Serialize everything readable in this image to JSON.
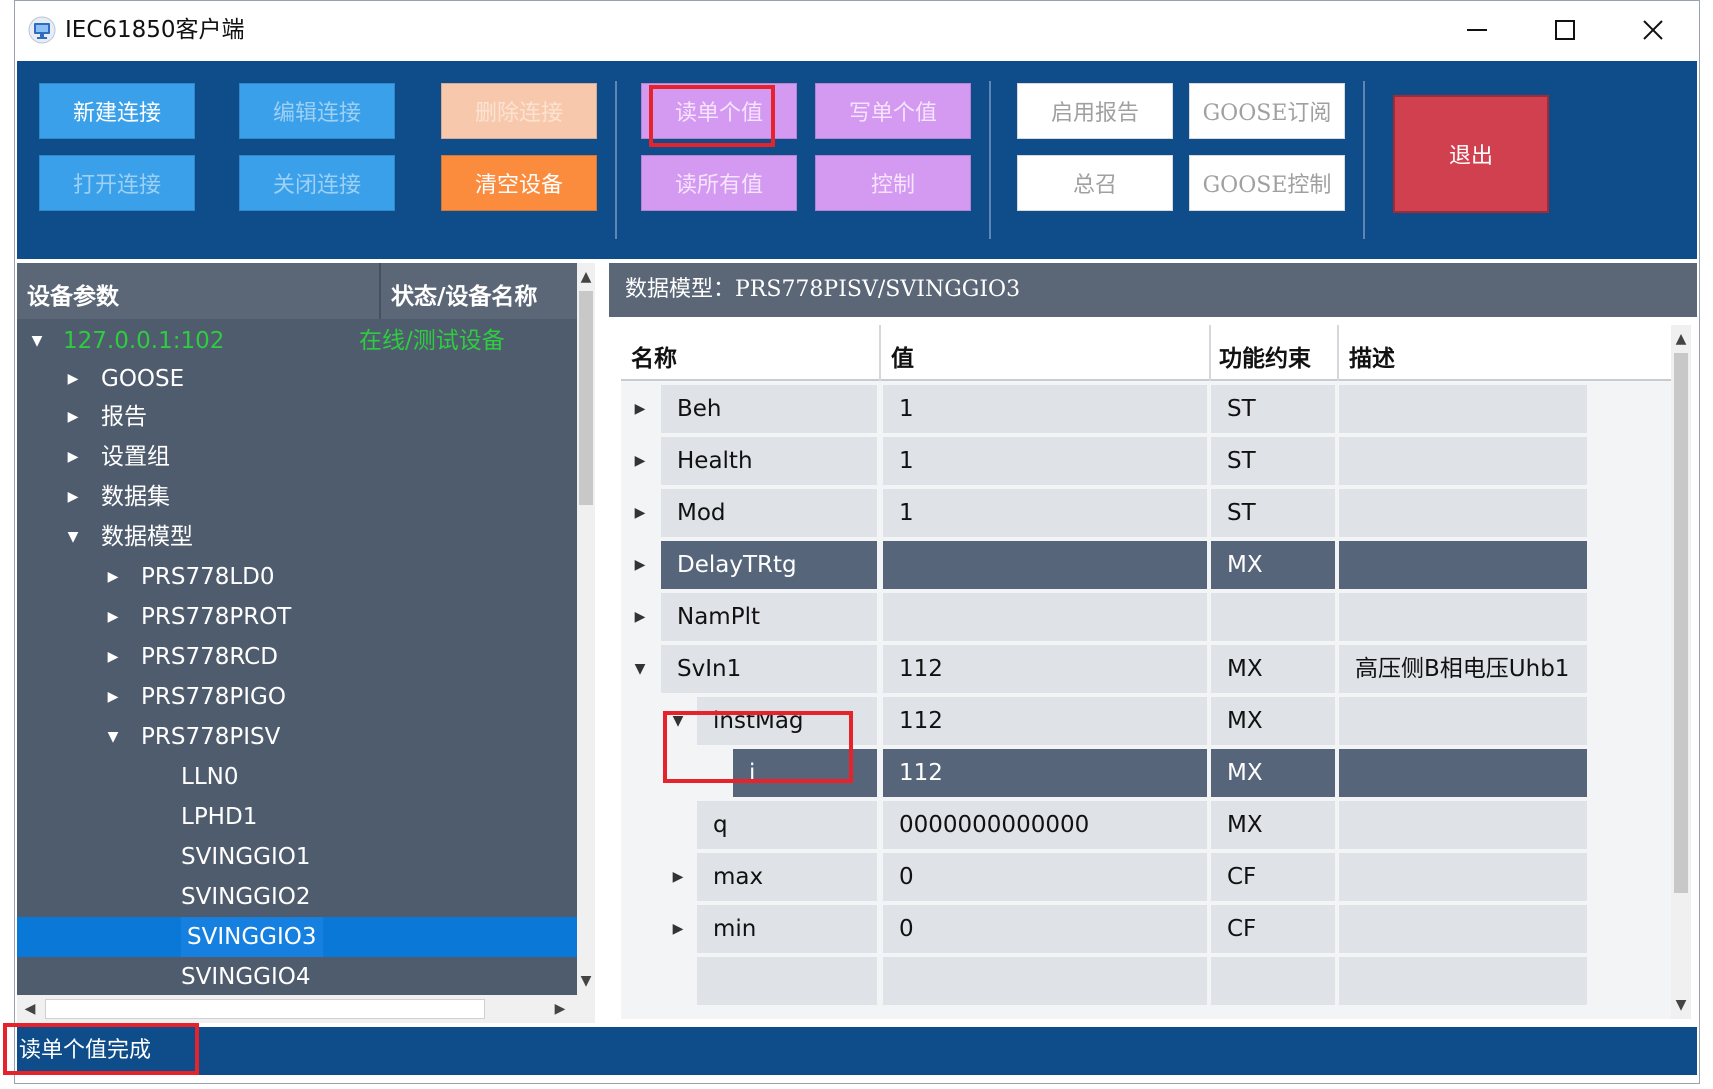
{
  "window": {
    "title": "IEC61850客户端"
  },
  "toolbar": {
    "new_connection": "新建连接",
    "edit_connection": "编辑连接",
    "delete_connection": "删除连接",
    "read_single": "读单个值",
    "write_single": "写单个值",
    "enable_report": "启用报告",
    "goose_subscribe": "GOOSE订阅",
    "exit": "退出",
    "open_connection": "打开连接",
    "close_connection": "关闭连接",
    "clear_device": "清空设备",
    "read_all": "读所有值",
    "control": "控制",
    "general_call": "总召",
    "goose_control": "GOOSE控制"
  },
  "tree": {
    "header_param": "设备参数",
    "header_status": "状态/设备名称",
    "root_label": "127.0.0.1:102",
    "root_status": "在线/测试设备",
    "items": [
      {
        "label": "GOOSE"
      },
      {
        "label": "报告"
      },
      {
        "label": "设置组"
      },
      {
        "label": "数据集"
      },
      {
        "label": "数据模型"
      },
      {
        "label": "PRS778LD0"
      },
      {
        "label": "PRS778PROT"
      },
      {
        "label": "PRS778RCD"
      },
      {
        "label": "PRS778PIGO"
      },
      {
        "label": "PRS778PISV"
      },
      {
        "label": "LLN0"
      },
      {
        "label": "LPHD1"
      },
      {
        "label": "SVINGGIO1"
      },
      {
        "label": "SVINGGIO2"
      },
      {
        "label": "SVINGGIO3"
      },
      {
        "label": "SVINGGIO4"
      }
    ]
  },
  "data_model": {
    "title": "数据模型：PRS778PISV/SVINGGIO3",
    "columns": {
      "name": "名称",
      "value": "值",
      "fc": "功能约束",
      "desc": "描述"
    },
    "rows": [
      {
        "name": "Beh",
        "value": "1",
        "fc": "ST",
        "desc": ""
      },
      {
        "name": "Health",
        "value": "1",
        "fc": "ST",
        "desc": ""
      },
      {
        "name": "Mod",
        "value": "1",
        "fc": "ST",
        "desc": ""
      },
      {
        "name": "DelayTRtg",
        "value": "",
        "fc": "MX",
        "desc": ""
      },
      {
        "name": "NamPlt",
        "value": "",
        "fc": "",
        "desc": ""
      },
      {
        "name": "SvIn1",
        "value": "112",
        "fc": "MX",
        "desc": "高压侧B相电压Uhb1"
      },
      {
        "name": "instMag",
        "value": "112",
        "fc": "MX",
        "desc": ""
      },
      {
        "name": "i",
        "value": "112",
        "fc": "MX",
        "desc": ""
      },
      {
        "name": "q",
        "value": "0000000000000",
        "fc": "MX",
        "desc": ""
      },
      {
        "name": "max",
        "value": "0",
        "fc": "CF",
        "desc": ""
      },
      {
        "name": "min",
        "value": "0",
        "fc": "CF",
        "desc": ""
      }
    ]
  },
  "status": {
    "message": "读单个值完成"
  },
  "colors": {
    "toolbar_bg": "#0f4c8a",
    "highlight_red": "#e6232a",
    "selection_blue": "#0a78d7",
    "online_green": "#2ecc40"
  }
}
